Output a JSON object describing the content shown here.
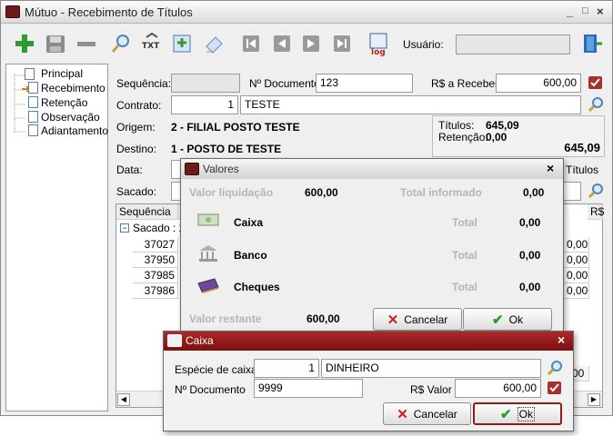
{
  "window": {
    "title": "Mútuo - Recebimento de Títulos",
    "controls": [
      "_",
      "□",
      "×"
    ]
  },
  "toolbar": {
    "user_label": "Usuário:",
    "user_value": ""
  },
  "tree": {
    "items": [
      "Principal",
      "Recebimento",
      "Retenção",
      "Observação",
      "Adiantamento"
    ]
  },
  "form": {
    "sequencia_label": "Sequência:",
    "sequencia_value": "",
    "documento_label": "Nº Documento",
    "documento_value": "123",
    "receber_label": "R$ a Receber",
    "receber_value": "600,00",
    "contrato_label": "Contrato:",
    "contrato_num": "1",
    "contrato_name": "TESTE",
    "origem_label": "Origem:",
    "origem_value": "2 - FILIAL POSTO TESTE",
    "destino_label": "Destino:",
    "destino_value": "1 - POSTO DE TESTE",
    "data_label": "Data:",
    "sacado_label": "Sacado:",
    "titulos_label": "Títulos:",
    "titulos_value": "645,09",
    "retencao_label": "Retenção:",
    "retencao_value": "0,00",
    "total_value": "645,09",
    "titulos_right": "Títulos"
  },
  "grid": {
    "col_sequencia": "Sequência",
    "col_rs": "R$",
    "group_label": "Sacado : 2",
    "rows": [
      "37027",
      "37950",
      "37985",
      "37986"
    ],
    "values": [
      "0,00",
      "0,00",
      "0,00",
      "0,00"
    ],
    "right_cell": "00"
  },
  "valores": {
    "title": "Valores",
    "liquidacao_label": "Valor liquidação",
    "liquidacao_value": "600,00",
    "informado_label": "Total informado",
    "informado_value": "0,00",
    "caixa": "Caixa",
    "banco": "Banco",
    "cheques": "Cheques",
    "total_label": "Total",
    "caixa_total": "0,00",
    "banco_total": "0,00",
    "cheques_total": "0,00",
    "restante_label": "Valor restante",
    "restante_value": "600,00",
    "cancel": "Cancelar",
    "ok": "Ok"
  },
  "caixa": {
    "title": "Caixa",
    "especie_label": "Espécie de caixa",
    "especie_num": "1",
    "especie_name": "DINHEIRO",
    "documento_label": "Nº Documento",
    "documento_value": "9999",
    "valor_label": "R$ Valor",
    "valor_value": "600,00",
    "cancel": "Cancelar",
    "ok": "Ok"
  },
  "colors": {
    "accent": "#7a1c1c",
    "caixa_title": "#8b1515"
  }
}
